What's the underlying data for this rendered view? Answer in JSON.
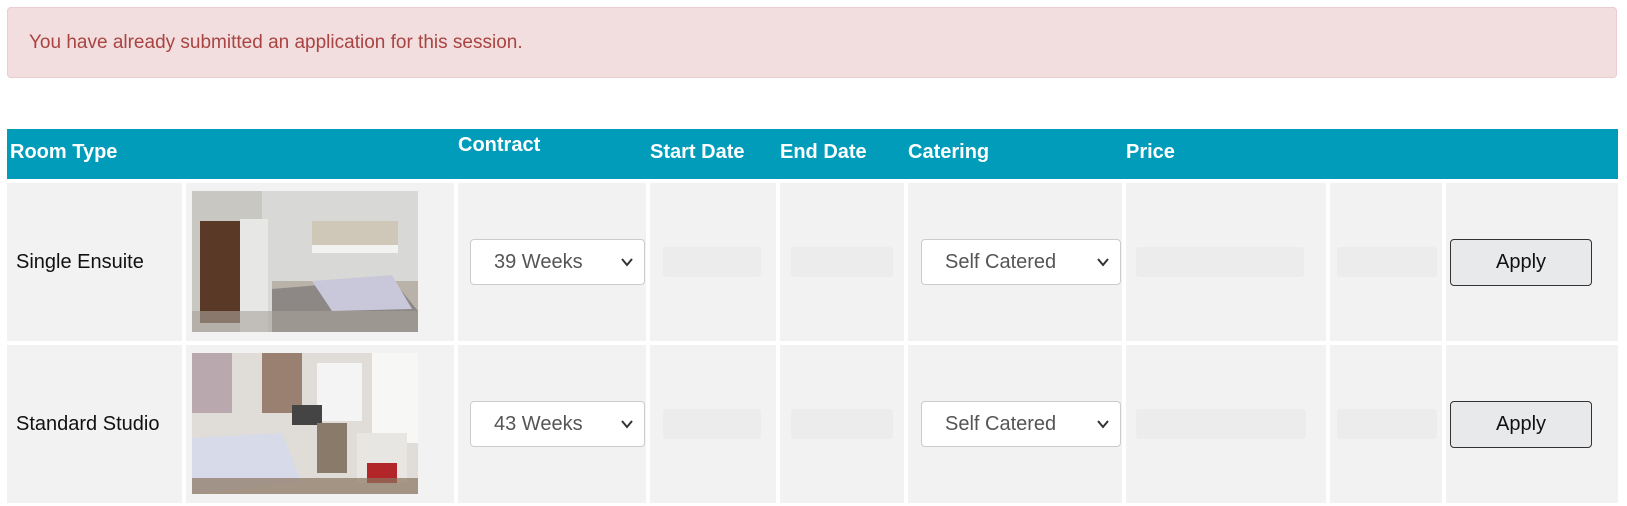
{
  "alert": {
    "message": "You have already submitted an application for this session."
  },
  "table": {
    "headers": {
      "room_type": "Room Type",
      "contract": "Contract",
      "start_date": "Start Date",
      "end_date": "End Date",
      "catering": "Catering",
      "price": "Price"
    },
    "rows": [
      {
        "room_type": "Single Ensuite",
        "contract": "39 Weeks",
        "catering": "Self Catered",
        "apply_label": "Apply"
      },
      {
        "room_type": "Standard Studio",
        "contract": "43 Weeks",
        "catering": "Self Catered",
        "apply_label": "Apply"
      }
    ]
  },
  "colors": {
    "header_bg": "#019cba",
    "alert_bg": "#f2dede",
    "alert_text": "#a94442",
    "cell_bg": "#f2f2f2"
  }
}
